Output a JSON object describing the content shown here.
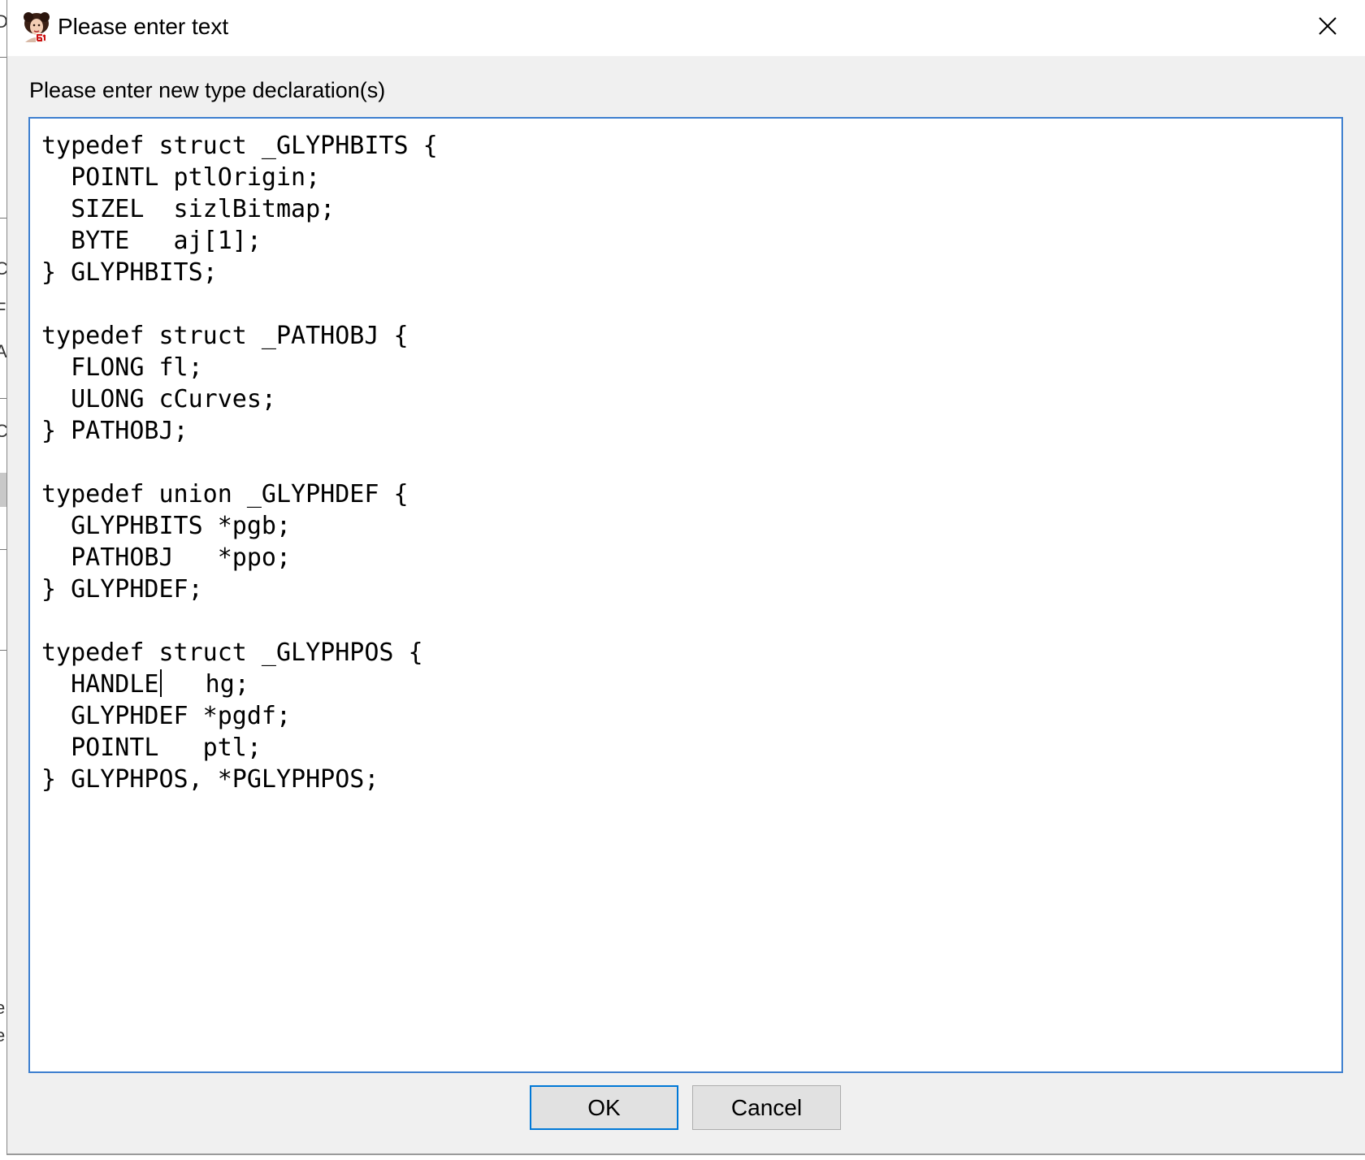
{
  "dialog": {
    "title": "Please enter text",
    "prompt": "Please enter new type declaration(s)",
    "code_before_caret": "typedef struct _GLYPHBITS {\n  POINTL ptlOrigin;\n  SIZEL  sizlBitmap;\n  BYTE   aj[1];\n} GLYPHBITS;\n\ntypedef struct _PATHOBJ {\n  FLONG fl;\n  ULONG cCurves;\n} PATHOBJ;\n\ntypedef union _GLYPHDEF {\n  GLYPHBITS *pgb;\n  PATHOBJ   *ppo;\n} GLYPHDEF;\n\ntypedef struct _GLYPHPOS {\n  HANDLE",
    "code_after_caret": "   hg;\n  GLYPHDEF *pgdf;\n  POINTL   ptl;\n} GLYPHPOS, *PGLYPHPOS;",
    "ok_label": "OK",
    "cancel_label": "Cancel"
  },
  "icons": {
    "app": "app-icon",
    "close": "close-icon"
  },
  "colors": {
    "dialog_bg": "#f0f0f0",
    "focus_border": "#0078d7",
    "textarea_border": "#3d7fcf",
    "button_bg": "#e1e1e1"
  }
}
